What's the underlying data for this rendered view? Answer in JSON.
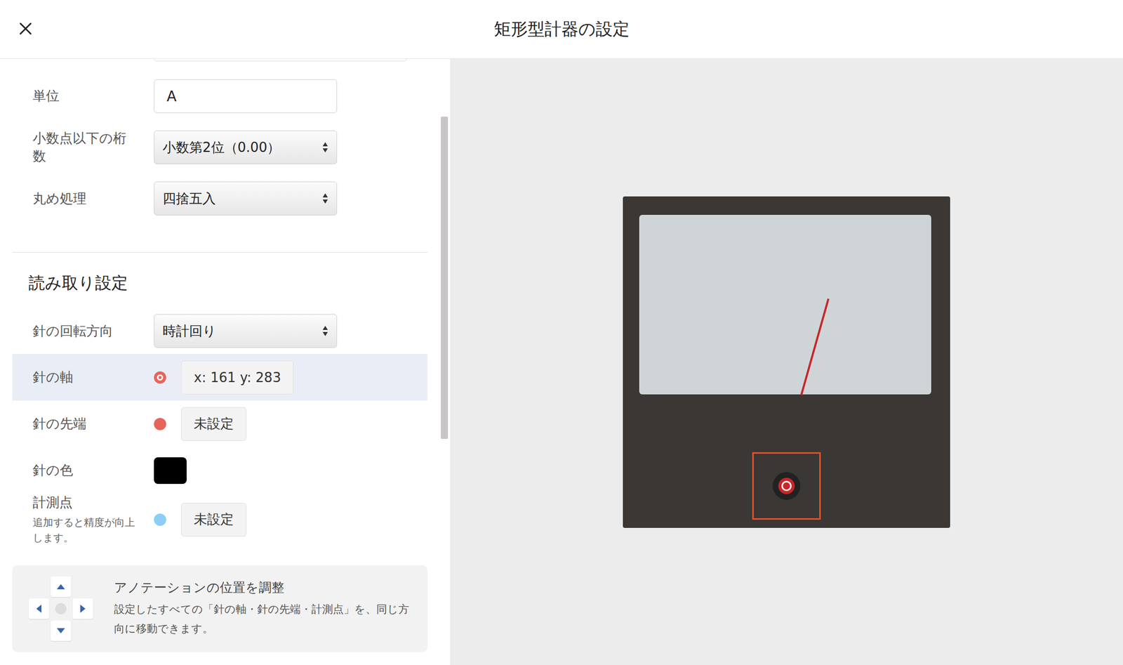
{
  "window": {
    "title": "矩形型計器の設定"
  },
  "form": {
    "fields": [
      {
        "label": "単位",
        "kind": "input",
        "value": "A"
      },
      {
        "label": "小数点以下の桁数",
        "kind": "select",
        "value": "小数第2位（0.00）"
      },
      {
        "label": "丸め処理",
        "kind": "select",
        "value": "四捨五入"
      }
    ]
  },
  "reading": {
    "heading": "読み取り設定",
    "rows": [
      {
        "label": "針の回転方向",
        "kind": "select",
        "value": "時計回り",
        "selected": false
      },
      {
        "label": "針の軸",
        "kind": "point",
        "value": "x: 161 y: 283",
        "color": "#e8645a",
        "selected": true
      },
      {
        "label": "針の先端",
        "kind": "point",
        "value": "未設定",
        "color": "#e8645a",
        "selected": false
      },
      {
        "label": "針の色",
        "kind": "swatch",
        "color": "#000000",
        "selected": false
      },
      {
        "label": "計測点",
        "hint": "追加すると精度が向上します。",
        "kind": "point",
        "value": "未設定",
        "color": "#8ccff5",
        "selected": false
      }
    ]
  },
  "adjust": {
    "title": "アノテーションの位置を調整",
    "description": "設定したすべての「針の軸・針の先端・計測点」を、同じ方向に移動できます。"
  }
}
